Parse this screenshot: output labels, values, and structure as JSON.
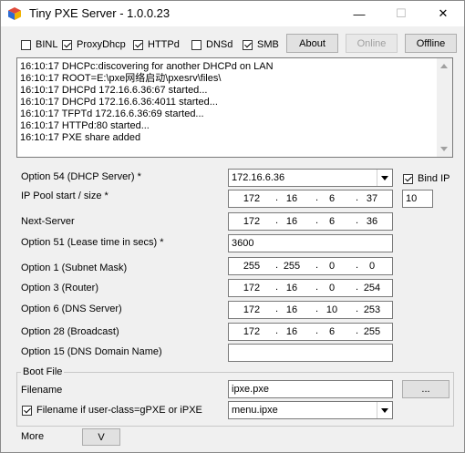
{
  "window": {
    "title": "Tiny PXE Server - 1.0.0.23",
    "icon": "cube-icon",
    "controls": {
      "minimize": "—",
      "maximize": "☐",
      "close": "✕"
    }
  },
  "toolbar": {
    "checkboxes": [
      {
        "label": "BINL",
        "checked": false
      },
      {
        "label": "ProxyDhcp",
        "checked": true
      },
      {
        "label": "HTTPd",
        "checked": true
      },
      {
        "label": "DNSd",
        "checked": false
      },
      {
        "label": "SMB",
        "checked": true
      }
    ],
    "about_label": "About",
    "online_label": "Online",
    "offline_label": "Offline"
  },
  "log": {
    "lines": [
      "16:10:17 DHCPc:discovering for another DHCPd on LAN",
      "16:10:17 ROOT=E:\\pxe网络启动\\pxesrv\\files\\",
      "16:10:17 DHCPd 172.16.6.36:67 started...",
      "16:10:17 DHCPd 172.16.6.36:4011 started...",
      "16:10:17 TFPTd 172.16.6.36:69 started...",
      "16:10:17 HTTPd:80 started...",
      "16:10:17 PXE share added"
    ]
  },
  "form": {
    "option54": {
      "label": "Option 54 (DHCP Server) *",
      "value": "172.16.6.36"
    },
    "bind_ip": {
      "label": "Bind IP",
      "checked": true
    },
    "ip_pool": {
      "label": "IP Pool start / size *",
      "octets": [
        "172",
        "16",
        "6",
        "37"
      ],
      "size": "10"
    },
    "next_server": {
      "label": "Next-Server",
      "octets": [
        "172",
        "16",
        "6",
        "36"
      ]
    },
    "option51": {
      "label": "Option 51 (Lease time in secs) *",
      "value": "3600"
    },
    "option1": {
      "label": "Option 1  (Subnet Mask)",
      "octets": [
        "255",
        "255",
        "0",
        "0"
      ]
    },
    "option3": {
      "label": "Option 3  (Router)",
      "octets": [
        "172",
        "16",
        "0",
        "254"
      ]
    },
    "option6": {
      "label": "Option 6  (DNS Server)",
      "octets": [
        "172",
        "16",
        "10",
        "253"
      ]
    },
    "option28": {
      "label": "Option 28 (Broadcast)",
      "octets": [
        "172",
        "16",
        "6",
        "255"
      ]
    },
    "option15": {
      "label": "Option 15 (DNS Domain Name)",
      "value": ""
    }
  },
  "boot_file": {
    "group_label": "Boot File",
    "filename_label": "Filename",
    "filename_value": "ipxe.pxe",
    "browse_label": "...",
    "userclass": {
      "label": "Filename if user-class=gPXE or iPXE",
      "checked": true,
      "value": "menu.ipxe"
    }
  },
  "footer": {
    "more_label": "More",
    "expand_label": "V"
  }
}
